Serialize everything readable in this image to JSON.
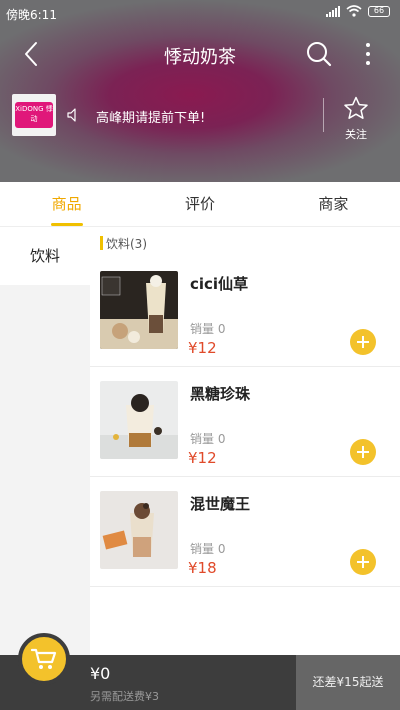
{
  "status_bar": {
    "time": "傍晚6:11",
    "battery": "66"
  },
  "header": {
    "title": "悸动奶茶",
    "logo_text": "XiDONG 悸动",
    "notice": "高峰期请提前下单!",
    "follow_label": "关注"
  },
  "tabs": [
    {
      "label": "商品",
      "active": true
    },
    {
      "label": "评价",
      "active": false
    },
    {
      "label": "商家",
      "active": false
    }
  ],
  "categories": [
    {
      "label": "饮料",
      "active": true
    }
  ],
  "section": {
    "title": "饮料(3)"
  },
  "products": [
    {
      "name": "cici仙草",
      "sales": "销量 0",
      "price": "¥12"
    },
    {
      "name": "黑糖珍珠",
      "sales": "销量 0",
      "price": "¥12"
    },
    {
      "name": "混世魔王",
      "sales": "销量 0",
      "price": "¥18"
    }
  ],
  "bottom_bar": {
    "total": "¥0",
    "delivery_fee": "另需配送费¥3",
    "checkout_label": "还差¥15起送"
  },
  "colors": {
    "accent": "#f3c22b",
    "active_tab": "#f0a800",
    "price": "#e04a2a",
    "bottom_bar": "#3d3d3d",
    "checkout_bg": "#666666"
  },
  "icons": {
    "back": "back-arrow-icon",
    "search": "search-icon",
    "more": "more-vertical-icon",
    "notice": "speaker-icon",
    "follow": "star-icon",
    "cart": "shopping-cart-icon",
    "add": "plus-icon"
  }
}
